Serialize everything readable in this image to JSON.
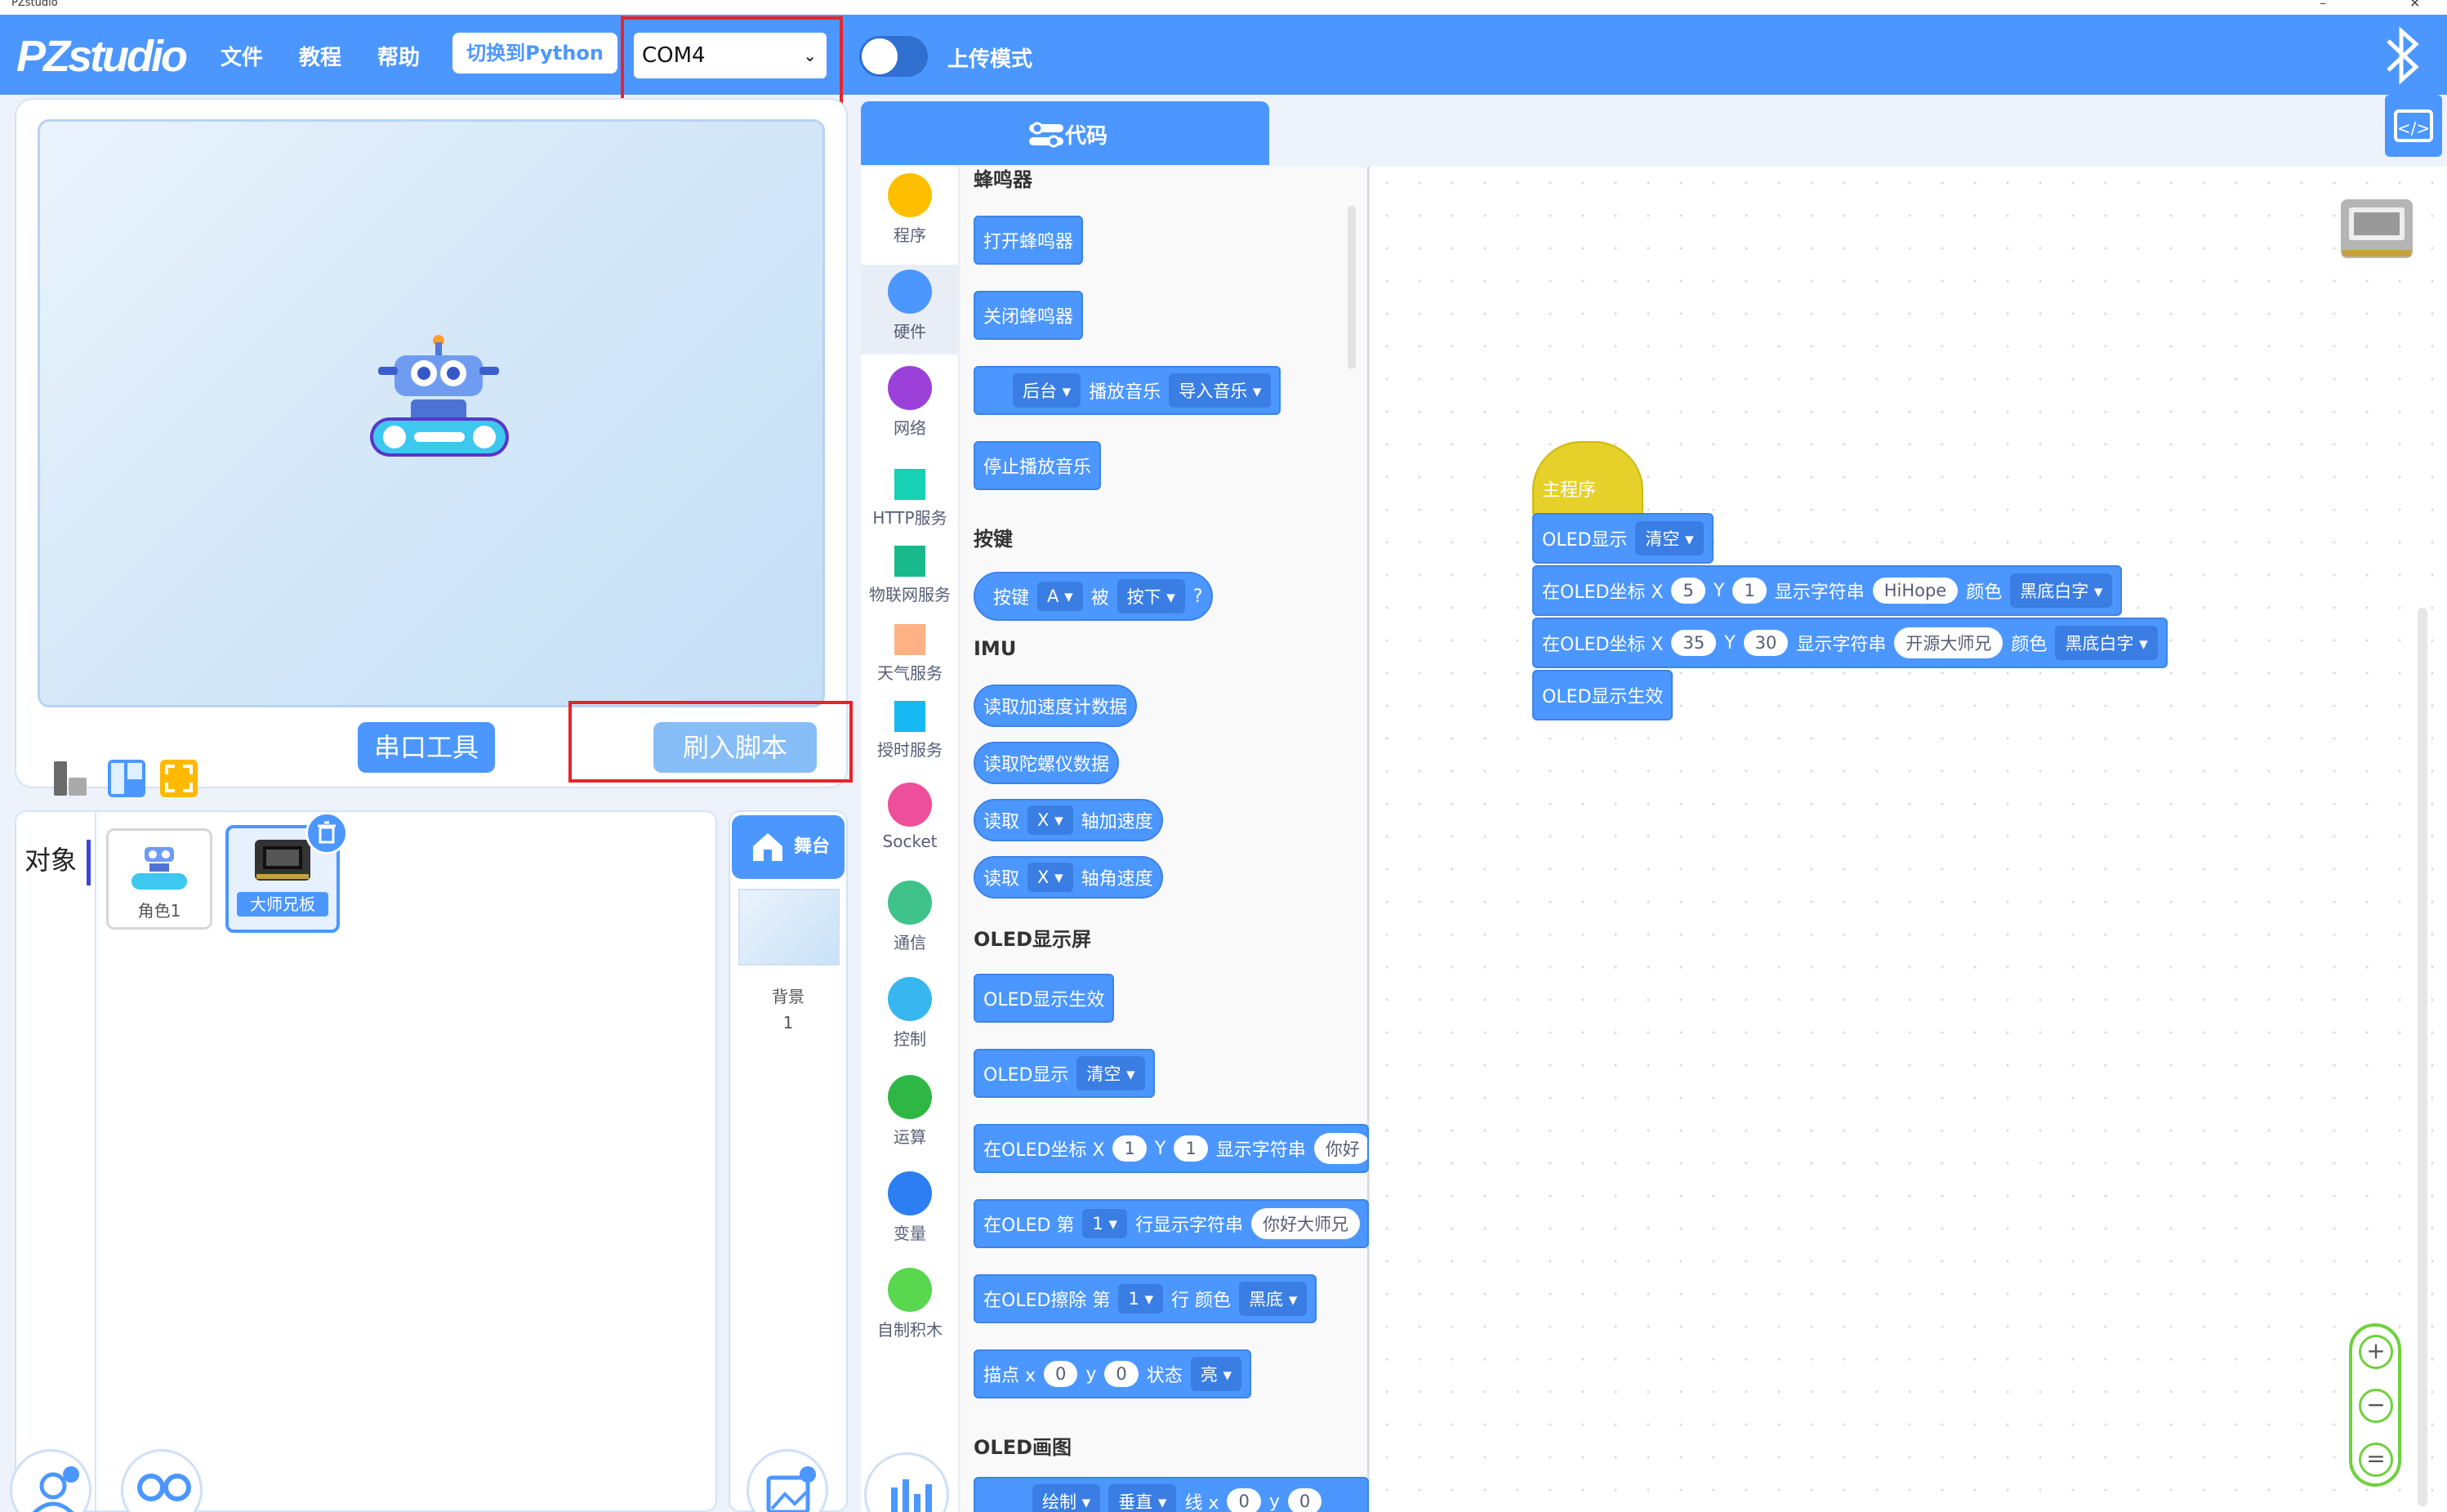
{
  "window": {
    "title": "PZstudio",
    "min": "–",
    "close": "✕"
  },
  "topbar": {
    "logo": "PZstudio",
    "menu": [
      "文件",
      "教程",
      "帮助"
    ],
    "switch_python": "切换到Python",
    "com_port": "COM4",
    "upload_mode": "上传模式"
  },
  "stage": {
    "serial_tool": "串口工具",
    "flash_script": "刷入脚本"
  },
  "objects": {
    "label": "对象",
    "items": [
      {
        "name": "角色1"
      },
      {
        "name": "大师兄板"
      }
    ]
  },
  "backdrop": {
    "stage_tab": "舞台",
    "label": "背景",
    "count": "1"
  },
  "code_tab": "代码",
  "categories": [
    {
      "label": "程序",
      "color": "#ffbf00",
      "shape": "circle"
    },
    {
      "label": "硬件",
      "color": "#4c97ff",
      "shape": "circle"
    },
    {
      "label": "网络",
      "color": "#9b40d8",
      "shape": "circle"
    },
    {
      "label": "HTTP服务",
      "color": "#16d1b4",
      "shape": "square"
    },
    {
      "label": "物联网服务",
      "color": "#18b98b",
      "shape": "square"
    },
    {
      "label": "天气服务",
      "color": "#ffb186",
      "shape": "square"
    },
    {
      "label": "授时服务",
      "color": "#17b9f5",
      "shape": "square"
    },
    {
      "label": "Socket",
      "color": "#ee4f9a",
      "shape": "circle"
    },
    {
      "label": "通信",
      "color": "#3fc38a",
      "shape": "circle"
    },
    {
      "label": "控制",
      "color": "#38b6f0",
      "shape": "circle"
    },
    {
      "label": "运算",
      "color": "#2fb746",
      "shape": "circle"
    },
    {
      "label": "变量",
      "color": "#2c7ef2",
      "shape": "circle"
    },
    {
      "label": "自制积木",
      "color": "#59d74f",
      "shape": "circle"
    }
  ],
  "palette": {
    "buzzer": {
      "title": "蜂鸣器",
      "open": "打开蜂鸣器",
      "close": "关闭蜂鸣器",
      "bg": "后台",
      "play": "播放音乐",
      "import": "导入音乐",
      "stop": "停止播放音乐"
    },
    "button": {
      "title": "按键",
      "key": "按键",
      "a": "A",
      "is": "被",
      "press": "按下",
      "q": "?"
    },
    "imu": {
      "title": "IMU",
      "accel": "读取加速度计数据",
      "gyro": "读取陀螺仪数据",
      "read": "读取",
      "x": "X",
      "acc_axis": "轴加速度",
      "ang_axis": "轴角速度"
    },
    "oled": {
      "title": "OLED显示屏",
      "effect": "OLED显示生效",
      "show": "OLED显示",
      "clear": "清空",
      "coord": "在OLED坐标 X",
      "one": "1",
      "y": "Y",
      "show_str": "显示字符串",
      "hello_short": "你好",
      "line": "在OLED 第",
      "line_str": "行显示字符串",
      "hello": "你好大师兄",
      "erase": "在OLED擦除 第",
      "erase_color": "行 颜色",
      "black": "黑底",
      "point": "描点 x",
      "zero": "0",
      "py": "y",
      "state": "状态",
      "bright": "亮"
    },
    "draw": {
      "title": "OLED画图",
      "draw": "绘制",
      "vert": "垂直",
      "linex": "线 x",
      "zero": "0",
      "y": "y"
    }
  },
  "workspace": {
    "main": "主程序",
    "show": "OLED显示",
    "clear": "清空",
    "coord": "在OLED坐标 X",
    "x1": "5",
    "y": "Y",
    "y1": "1",
    "show_str": "显示字符串",
    "str1": "HiHope",
    "color": "颜色",
    "white_black": "黑底白字",
    "x2": "35",
    "y2": "30",
    "str2": "开源大师兄",
    "effect": "OLED显示生效"
  },
  "zoom": {
    "in": "+",
    "out": "−",
    "reset": "="
  }
}
